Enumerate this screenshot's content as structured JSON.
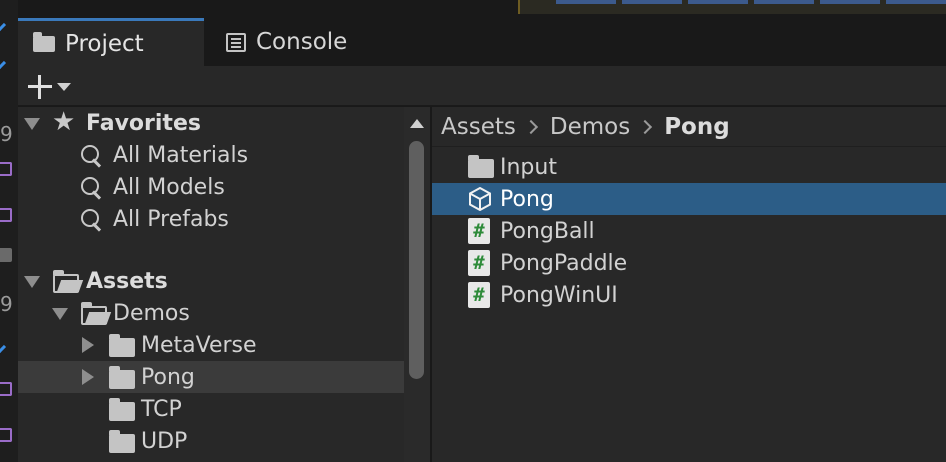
{
  "tabs": {
    "project": {
      "label": "Project",
      "icon": "folder-icon",
      "active": true
    },
    "console": {
      "label": "Console",
      "icon": "console-icon",
      "active": false
    }
  },
  "toolbar": {
    "add_icon": "plus-icon",
    "add_dropdown_icon": "caret-down-icon"
  },
  "tree": {
    "favorites": {
      "label": "Favorites",
      "items": [
        {
          "label": "All Materials",
          "icon": "search-icon"
        },
        {
          "label": "All Models",
          "icon": "search-icon"
        },
        {
          "label": "All Prefabs",
          "icon": "search-icon"
        }
      ]
    },
    "assets": {
      "label": "Assets",
      "demos": {
        "label": "Demos",
        "children": [
          {
            "label": "MetaVerse",
            "expandable": true
          },
          {
            "label": "Pong",
            "expandable": true,
            "highlighted": true
          },
          {
            "label": "TCP",
            "expandable": false
          },
          {
            "label": "UDP",
            "expandable": false
          }
        ]
      }
    }
  },
  "breadcrumb": {
    "items": [
      "Assets",
      "Demos"
    ],
    "current": "Pong"
  },
  "files": [
    {
      "label": "Input",
      "type": "folder",
      "icon": "folder-icon"
    },
    {
      "label": "Pong",
      "type": "scene",
      "icon": "unity-scene-icon",
      "selected": true
    },
    {
      "label": "PongBall",
      "type": "script",
      "icon": "csharp-script-icon"
    },
    {
      "label": "PongPaddle",
      "type": "script",
      "icon": "csharp-script-icon"
    },
    {
      "label": "PongWinUI",
      "type": "script",
      "icon": "csharp-script-icon"
    }
  ],
  "colors": {
    "panel_bg": "#282828",
    "selection": "#2c5d87",
    "active_tab_accent": "#3a79bb",
    "script_hash": "#2e8b3a"
  }
}
